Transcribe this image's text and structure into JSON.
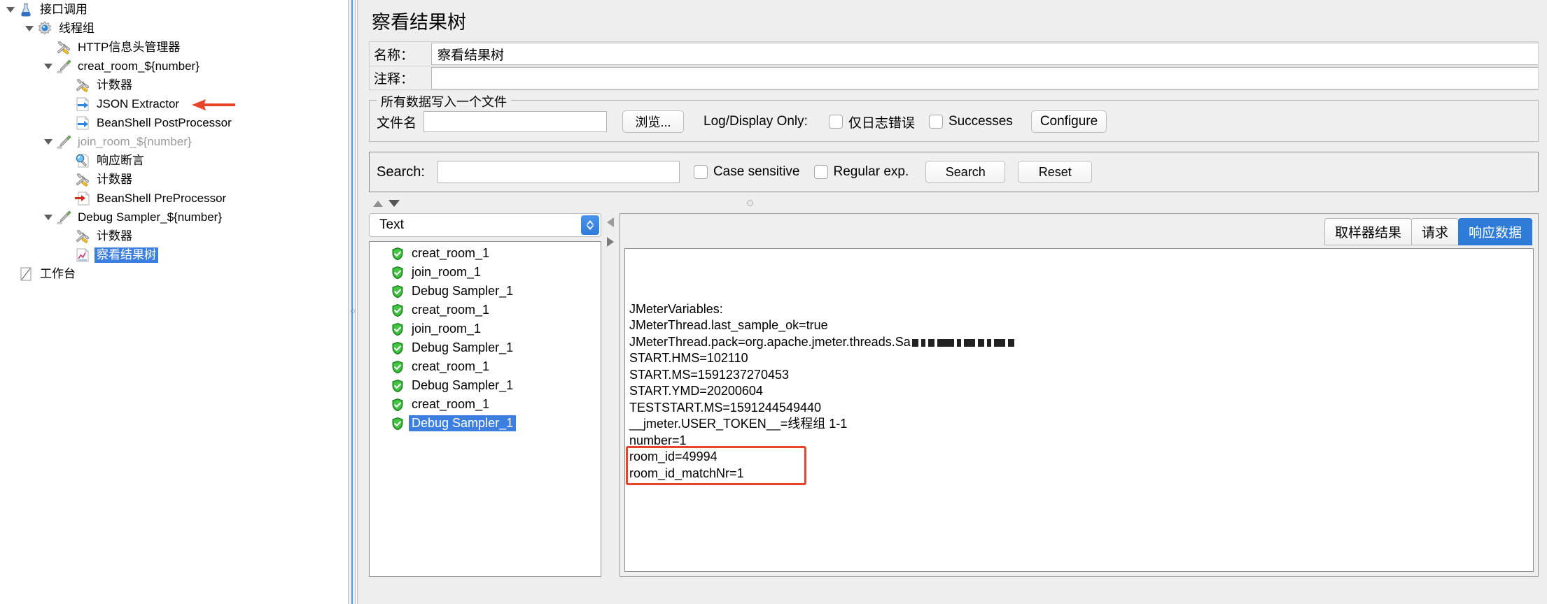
{
  "tree": {
    "nodes": [
      {
        "label": "接口调用",
        "indent": 0,
        "icon": "testplan-icon",
        "twisty": "down",
        "state": "normal"
      },
      {
        "label": "线程组",
        "indent": 1,
        "icon": "threadgroup-icon",
        "twisty": "down",
        "state": "normal"
      },
      {
        "label": "HTTP信息头管理器",
        "indent": 2,
        "icon": "config-icon",
        "twisty": "none",
        "state": "normal"
      },
      {
        "label": "creat_room_${number}",
        "indent": 2,
        "icon": "sampler-icon",
        "twisty": "down",
        "state": "normal"
      },
      {
        "label": "计数器",
        "indent": 3,
        "icon": "config-icon",
        "twisty": "none",
        "state": "normal"
      },
      {
        "label": "JSON Extractor",
        "indent": 3,
        "icon": "postprocessor-icon",
        "twisty": "none",
        "state": "normal"
      },
      {
        "label": "BeanShell PostProcessor",
        "indent": 3,
        "icon": "postprocessor-icon",
        "twisty": "none",
        "state": "normal"
      },
      {
        "label": "join_room_${number}",
        "indent": 2,
        "icon": "sampler-icon",
        "twisty": "down",
        "state": "disabled"
      },
      {
        "label": "响应断言",
        "indent": 3,
        "icon": "assertion-icon",
        "twisty": "none",
        "state": "normal"
      },
      {
        "label": "计数器",
        "indent": 3,
        "icon": "config-icon",
        "twisty": "none",
        "state": "normal"
      },
      {
        "label": "BeanShell PreProcessor",
        "indent": 3,
        "icon": "preprocessor-icon",
        "twisty": "none",
        "state": "normal"
      },
      {
        "label": "Debug Sampler_${number}",
        "indent": 2,
        "icon": "sampler-icon",
        "twisty": "down",
        "state": "normal"
      },
      {
        "label": "计数器",
        "indent": 3,
        "icon": "config-icon",
        "twisty": "none",
        "state": "normal"
      },
      {
        "label": "察看结果树",
        "indent": 3,
        "icon": "listener-icon",
        "twisty": "none",
        "state": "selected"
      },
      {
        "label": "工作台",
        "indent": 0,
        "icon": "workbench-icon",
        "twisty": "none",
        "state": "normal"
      }
    ],
    "annotation_arrow_color": "#e8442a"
  },
  "panel": {
    "title": "察看结果树",
    "name_label": "名称：",
    "name_value": "察看结果树",
    "comment_label": "注释：",
    "comment_value": ""
  },
  "filegroup": {
    "legend": "所有数据写入一个文件",
    "filename_label": "文件名",
    "filename_value": "",
    "browse_button": "浏览...",
    "log_display_only_label": "Log/Display Only:",
    "errors_only_label": "仅日志错误",
    "errors_only_checked": false,
    "successes_label": "Successes",
    "successes_checked": false,
    "configure_button": "Configure"
  },
  "search": {
    "label": "Search:",
    "value": "",
    "case_sensitive_label": "Case sensitive",
    "case_sensitive_checked": false,
    "regular_exp_label": "Regular exp.",
    "regular_exp_checked": false,
    "search_button": "Search",
    "reset_button": "Reset"
  },
  "renderer": {
    "selected": "Text"
  },
  "results": [
    {
      "label": "creat_room_1",
      "status": "success",
      "selected": false
    },
    {
      "label": "join_room_1",
      "status": "success",
      "selected": false
    },
    {
      "label": "Debug Sampler_1",
      "status": "success",
      "selected": false
    },
    {
      "label": "creat_room_1",
      "status": "success",
      "selected": false
    },
    {
      "label": "join_room_1",
      "status": "success",
      "selected": false
    },
    {
      "label": "Debug Sampler_1",
      "status": "success",
      "selected": false
    },
    {
      "label": "creat_room_1",
      "status": "success",
      "selected": false
    },
    {
      "label": "Debug Sampler_1",
      "status": "success",
      "selected": false
    },
    {
      "label": "creat_room_1",
      "status": "success",
      "selected": false
    },
    {
      "label": "Debug Sampler_1",
      "status": "success",
      "selected": true
    }
  ],
  "tabs": [
    {
      "label": "取样器结果",
      "active": false
    },
    {
      "label": "请求",
      "active": false
    },
    {
      "label": "响应数据",
      "active": true
    }
  ],
  "response": {
    "lines": [
      "JMeterVariables:",
      "JMeterThread.last_sample_ok=true",
      "JMeterThread.pack=org.apache.jmeter.threads.Sa",
      "START.HMS=102110",
      "START.MS=1591237270453",
      "START.YMD=20200604",
      "TESTSTART.MS=1591244549440",
      "__jmeter.USER_TOKEN__=线程组 1-1",
      "number=1",
      "room_id=49994",
      "room_id_matchNr=1"
    ],
    "obscured_line_index": 2,
    "highlight_color": "#e8442a",
    "highlighted_lines": [
      "room_id=49994",
      "room_id_matchNr=1"
    ]
  }
}
